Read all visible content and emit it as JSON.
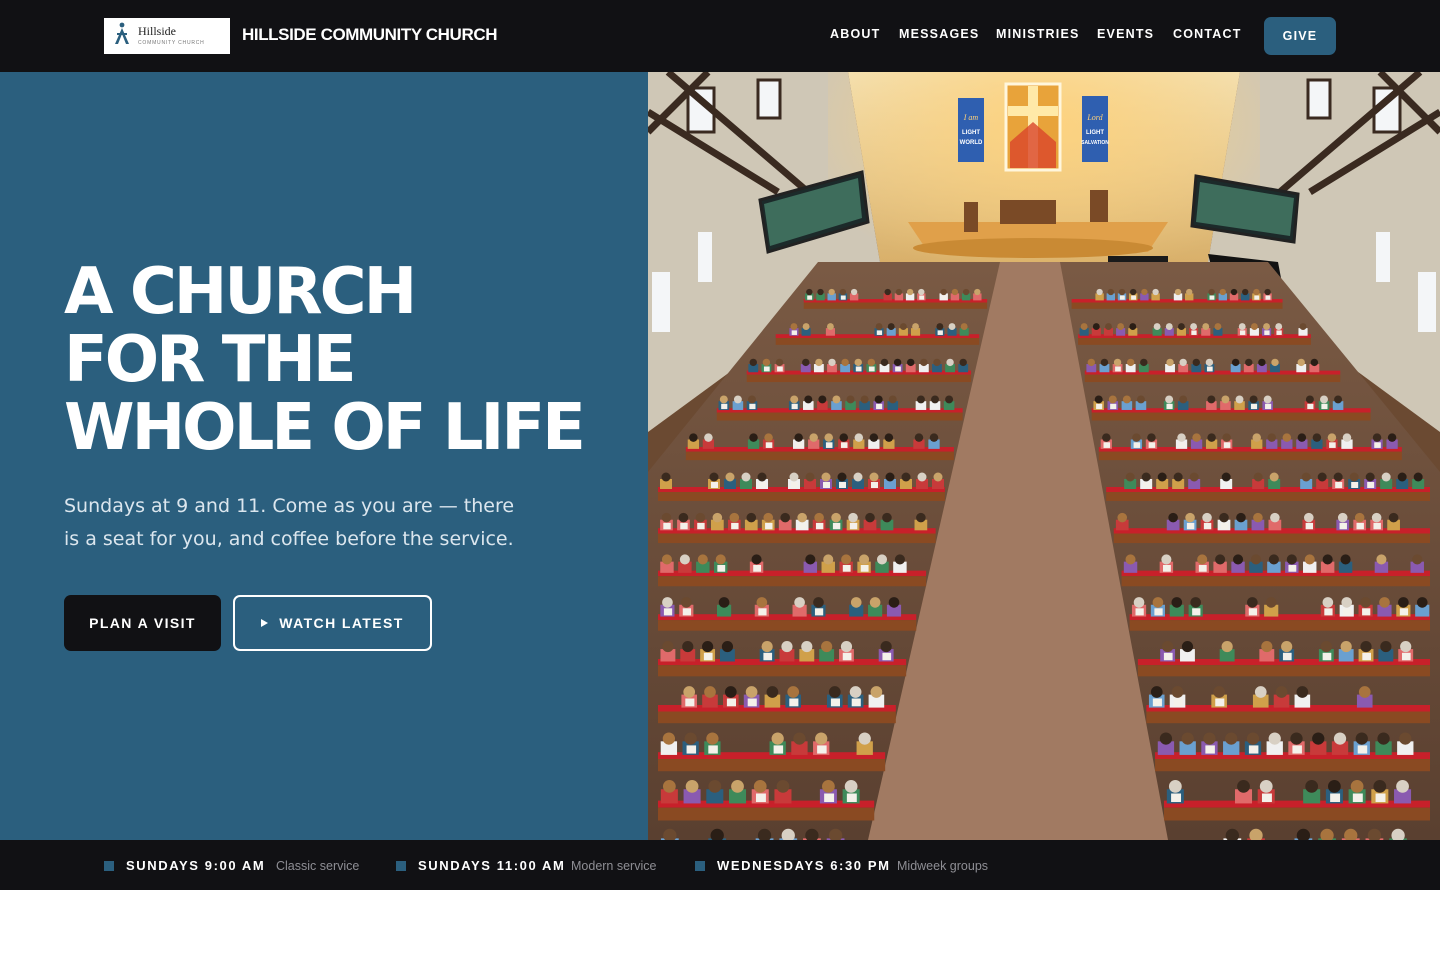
{
  "header": {
    "logo_word": "Hillside",
    "logo_sub": "Community Church",
    "site_name": "HILLSIDE COMMUNITY CHURCH",
    "nav": [
      "ABOUT",
      "MESSAGES",
      "MINISTRIES",
      "EVENTS",
      "CONTACT"
    ],
    "give_label": "GIVE"
  },
  "hero": {
    "headline_lines": [
      "A CHURCH",
      "FOR THE",
      "WHOLE OF LIFE"
    ],
    "subtext": "Sundays at 9 and 11. Come as you are — there is a seat for you, and coffee before the service.",
    "primary_button": "PLAN A VISIT",
    "secondary_button": "WATCH LATEST",
    "banner_left": [
      "I am",
      "LIGHT",
      "WORLD"
    ],
    "banner_right": [
      "Lord",
      "LIGHT",
      "SALVATION"
    ]
  },
  "schedule": [
    {
      "time": "SUNDAYS 9:00 AM",
      "label": "Classic service"
    },
    {
      "time": "SUNDAYS 11:00 AM",
      "label": "Modern service"
    },
    {
      "time": "WEDNESDAYS 6:30 PM",
      "label": "Midweek groups"
    }
  ],
  "colors": {
    "brand_blue": "#2b5f7e",
    "dark": "#111114",
    "pew_wood": "#8a4a22",
    "cushion_red": "#c8202a"
  },
  "icons": {
    "logo": "cross-figure-icon",
    "secondary_button": "play-icon",
    "schedule_bullet": "square-bullet-icon"
  }
}
